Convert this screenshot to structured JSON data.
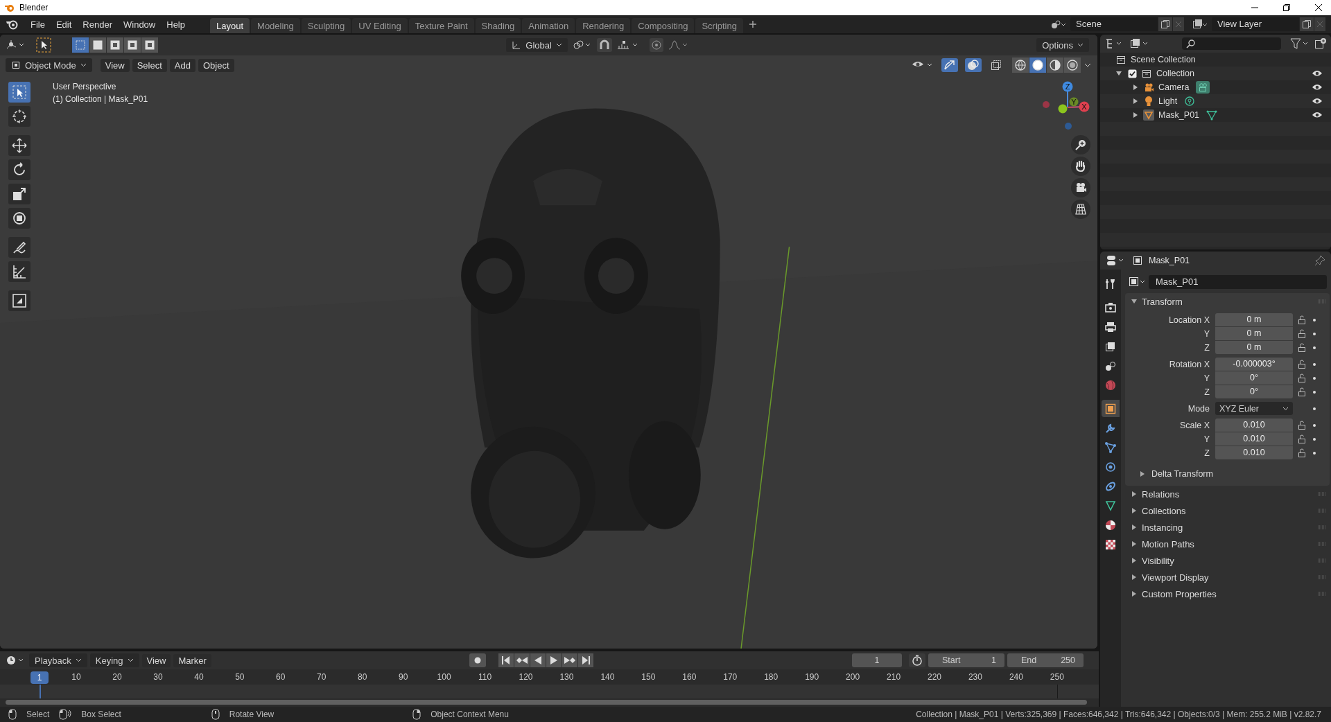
{
  "window": {
    "title": "Blender"
  },
  "menus": [
    "File",
    "Edit",
    "Render",
    "Window",
    "Help"
  ],
  "workspaces": [
    {
      "label": "Layout",
      "selected": true
    },
    {
      "label": "Modeling",
      "selected": false
    },
    {
      "label": "Sculpting",
      "selected": false
    },
    {
      "label": "UV Editing",
      "selected": false
    },
    {
      "label": "Texture Paint",
      "selected": false
    },
    {
      "label": "Shading",
      "selected": false
    },
    {
      "label": "Animation",
      "selected": false
    },
    {
      "label": "Rendering",
      "selected": false
    },
    {
      "label": "Compositing",
      "selected": false
    },
    {
      "label": "Scripting",
      "selected": false
    }
  ],
  "scene": {
    "name": "Scene"
  },
  "view_layer": {
    "name": "View Layer"
  },
  "tool_header": {
    "select_modes": [
      {
        "selected": true
      },
      {
        "selected": false
      },
      {
        "selected": false
      },
      {
        "selected": false
      },
      {
        "selected": false
      }
    ],
    "orientation": "Global",
    "options": "Options"
  },
  "viewport_header": {
    "mode": "Object Mode",
    "menus": [
      "View",
      "Select",
      "Add",
      "Object"
    ],
    "toggles": [
      {
        "kind": "visibility",
        "on": false
      },
      {
        "kind": "gizmo",
        "on": true
      },
      {
        "kind": "overlay",
        "on": true
      },
      {
        "kind": "xray",
        "on": false
      }
    ],
    "shading": [
      {
        "kind": "wireframe",
        "selected": false
      },
      {
        "kind": "solid",
        "selected": true
      },
      {
        "kind": "material",
        "selected": false
      },
      {
        "kind": "rendered",
        "selected": false
      }
    ]
  },
  "viewport": {
    "perspective": "User Perspective",
    "object_info": "(1) Collection | Mask_P01",
    "gizmo_axes": [
      "Z",
      "Y",
      "X"
    ]
  },
  "toolbar": [
    {
      "kind": "select",
      "selected": true
    },
    {
      "kind": "cursor",
      "selected": false
    },
    {
      "kind": "move",
      "selected": false
    },
    {
      "kind": "rotate",
      "selected": false
    },
    {
      "kind": "scale",
      "selected": false
    },
    {
      "kind": "transform",
      "selected": false
    },
    {
      "kind": "annotate",
      "selected": false
    },
    {
      "kind": "measure",
      "selected": false
    },
    {
      "kind": "add",
      "selected": false
    }
  ],
  "outliner": {
    "root": "Scene Collection",
    "items": [
      {
        "label": "Collection",
        "expanded": true,
        "checked": true,
        "children": [
          {
            "label": "Camera",
            "kind": "camera",
            "expanded": false
          },
          {
            "label": "Light",
            "kind": "light",
            "expanded": false
          },
          {
            "label": "Mask_P01",
            "kind": "mesh",
            "expanded": false
          }
        ]
      }
    ]
  },
  "properties": {
    "object_name": "Mask_P01",
    "datablock": "Mask_P01",
    "tabs": [
      {
        "kind": "tool",
        "selected": false
      },
      {
        "kind": "render",
        "selected": false
      },
      {
        "kind": "output",
        "selected": false
      },
      {
        "kind": "view_layer",
        "selected": false
      },
      {
        "kind": "scene",
        "selected": false
      },
      {
        "kind": "world",
        "selected": false
      },
      {
        "kind": "object",
        "selected": true
      },
      {
        "kind": "modifier",
        "selected": false
      },
      {
        "kind": "particles",
        "selected": false
      },
      {
        "kind": "physics",
        "selected": false
      },
      {
        "kind": "constraints",
        "selected": false
      },
      {
        "kind": "data",
        "selected": false
      },
      {
        "kind": "material",
        "selected": false
      },
      {
        "kind": "texture",
        "selected": false
      }
    ],
    "transform": {
      "title": "Transform",
      "expanded": true,
      "groups": [
        [
          {
            "label": "Location X",
            "value": "0 m",
            "kind": "number"
          },
          {
            "label": "Y",
            "value": "0 m",
            "kind": "number"
          },
          {
            "label": "Z",
            "value": "0 m",
            "kind": "number"
          }
        ],
        [
          {
            "label": "Rotation X",
            "value": "-0.000003°",
            "kind": "number"
          },
          {
            "label": "Y",
            "value": "0°",
            "kind": "number"
          },
          {
            "label": "Z",
            "value": "0°",
            "kind": "number"
          }
        ],
        [
          {
            "label": "Mode",
            "value": "XYZ Euler",
            "kind": "dropdown"
          }
        ],
        [
          {
            "label": "Scale X",
            "value": "0.010",
            "kind": "number"
          },
          {
            "label": "Y",
            "value": "0.010",
            "kind": "number"
          },
          {
            "label": "Z",
            "value": "0.010",
            "kind": "number"
          }
        ]
      ],
      "subpanels": [
        {
          "title": "Delta Transform",
          "expanded": false
        }
      ]
    },
    "panels": [
      {
        "title": "Relations",
        "expanded": false
      },
      {
        "title": "Collections",
        "expanded": false
      },
      {
        "title": "Instancing",
        "expanded": false
      },
      {
        "title": "Motion Paths",
        "expanded": false
      },
      {
        "title": "Visibility",
        "expanded": false
      },
      {
        "title": "Viewport Display",
        "expanded": false
      },
      {
        "title": "Custom Properties",
        "expanded": false
      }
    ]
  },
  "timeline": {
    "menus": [
      {
        "label": "Playback",
        "kind": "dropdown"
      },
      {
        "label": "Keying",
        "kind": "dropdown"
      },
      {
        "label": "View",
        "kind": "menu"
      },
      {
        "label": "Marker",
        "kind": "menu"
      }
    ],
    "current_frame": "1",
    "start_label": "Start",
    "start": "1",
    "end_label": "End",
    "end": "250",
    "playhead": "1",
    "ruler": [
      "10",
      "20",
      "30",
      "40",
      "50",
      "60",
      "70",
      "80",
      "90",
      "100",
      "110",
      "120",
      "130",
      "140",
      "150",
      "160",
      "170",
      "180",
      "190",
      "200",
      "210",
      "220",
      "230",
      "240",
      "250"
    ]
  },
  "status_bar": {
    "hints": [
      {
        "label": "Select",
        "kind": "mouse-left"
      },
      {
        "label": "Box Select",
        "kind": "mouse-drag"
      },
      {
        "label": "Rotate View",
        "kind": "mouse-middle"
      },
      {
        "label": "Object Context Menu",
        "kind": "mouse-right"
      }
    ],
    "stats": "Collection | Mask_P01 | Verts:325,369 | Faces:646,342 | Tris:646,342 | Objects:0/3 | Mem: 255.2 MiB | v2.82.7"
  }
}
